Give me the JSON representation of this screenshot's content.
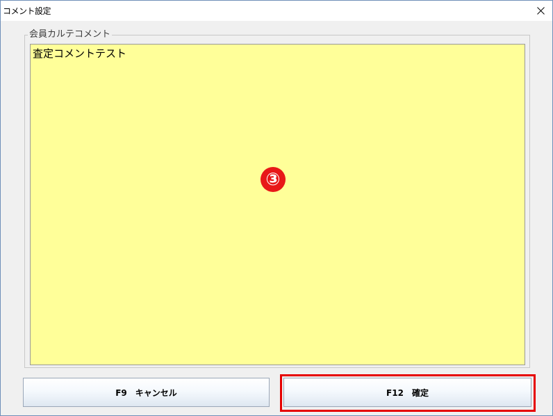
{
  "window": {
    "title": "コメント設定",
    "close_icon": "close-icon"
  },
  "group": {
    "label": "会員カルテコメント",
    "comment_value": "査定コメントテスト",
    "comment_bg_color": "#ffff99"
  },
  "annotation": {
    "marker_text": "③",
    "marker_color": "#e81818",
    "highlight_color": "#e60000"
  },
  "buttons": {
    "cancel_label": "F9　キャンセル",
    "confirm_label": "F12　確定"
  }
}
